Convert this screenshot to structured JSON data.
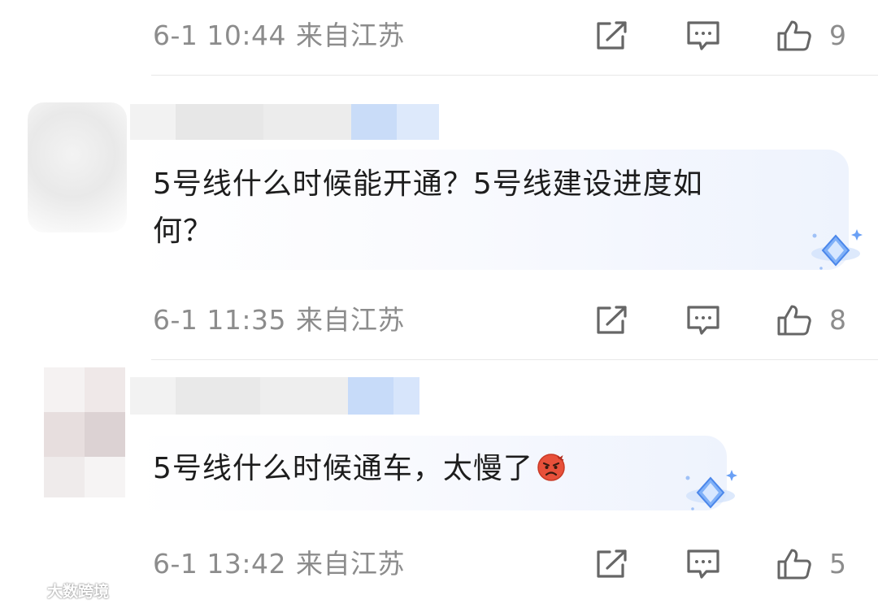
{
  "comments": [
    {
      "date": "6-1 10:44",
      "location": "来自江苏",
      "likes": "9"
    },
    {
      "text_line1": "5号线什么时候能开通？5号线建设进度如",
      "text_line2": "何？",
      "date": "6-1 11:35",
      "location": "来自江苏",
      "likes": "8"
    },
    {
      "text_line1": "5号线什么时候通车，太慢了",
      "emoji": "angry-face-icon",
      "date": "6-1 13:42",
      "location": "来自江苏",
      "likes": "5"
    }
  ],
  "icons": {
    "share": "share-icon",
    "reply": "comment-icon",
    "like": "thumbs-up-icon",
    "badge": "diamond-badge-icon"
  },
  "colors": {
    "meta_text": "#8c8c8c",
    "body_text": "#1d1d1d",
    "badge_blue": "#6aa0f5",
    "emoji_red": "#e8503a"
  },
  "watermark": {
    "text": "大数跨境"
  }
}
